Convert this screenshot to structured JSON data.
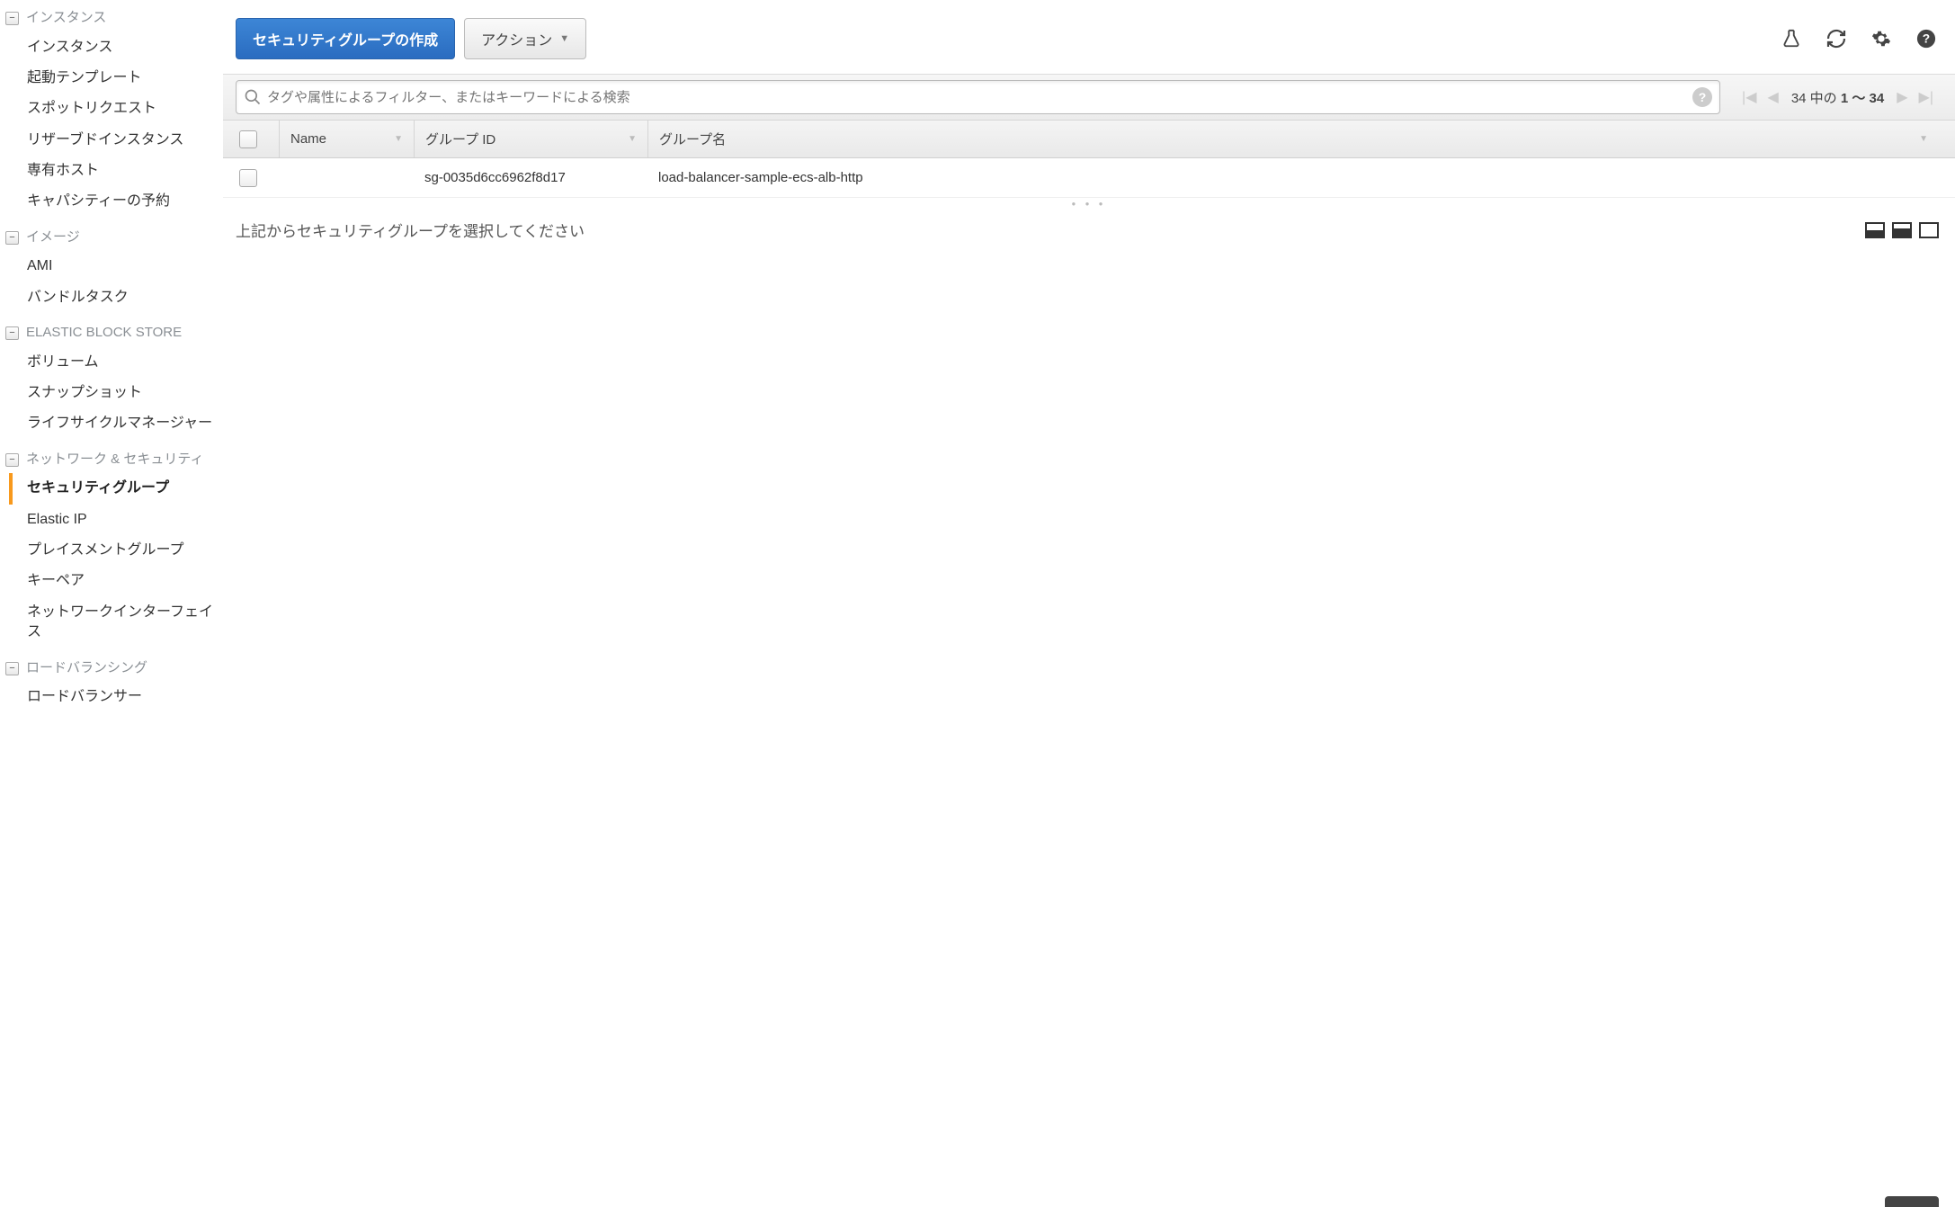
{
  "sidebar": {
    "sections": [
      {
        "title": "インスタンス",
        "items": [
          {
            "label": "インスタンス"
          },
          {
            "label": "起動テンプレート"
          },
          {
            "label": "スポットリクエスト"
          },
          {
            "label": "リザーブドインスタンス"
          },
          {
            "label": "専有ホスト"
          },
          {
            "label": "キャパシティーの予約"
          }
        ]
      },
      {
        "title": "イメージ",
        "items": [
          {
            "label": "AMI"
          },
          {
            "label": "バンドルタスク"
          }
        ]
      },
      {
        "title": "ELASTIC BLOCK STORE",
        "items": [
          {
            "label": "ボリューム"
          },
          {
            "label": "スナップショット"
          },
          {
            "label": "ライフサイクルマネージャー"
          }
        ]
      },
      {
        "title": "ネットワーク & セキュリティ",
        "items": [
          {
            "label": "セキュリティグループ",
            "active": true
          },
          {
            "label": "Elastic IP"
          },
          {
            "label": "プレイスメントグループ"
          },
          {
            "label": "キーペア"
          },
          {
            "label": "ネットワークインターフェイス"
          }
        ]
      },
      {
        "title": "ロードバランシング",
        "items": [
          {
            "label": "ロードバランサー"
          }
        ]
      }
    ]
  },
  "toolbar": {
    "create_label": "セキュリティグループの作成",
    "actions_label": "アクション"
  },
  "filter": {
    "placeholder": "タグや属性によるフィルター、またはキーワードによる検索"
  },
  "pager": {
    "text_prefix": "34 中の ",
    "range": "1 〜 34"
  },
  "table": {
    "headers": {
      "name": "Name",
      "group_id": "グループ ID",
      "group_name": "グループ名"
    },
    "rows": [
      {
        "name": "",
        "group_id": "sg-0035d6cc6962f8d17",
        "group_name": "load-balancer-sample-ecs-alb-http"
      }
    ]
  },
  "detail": {
    "message": "上記からセキュリティグループを選択してください"
  }
}
